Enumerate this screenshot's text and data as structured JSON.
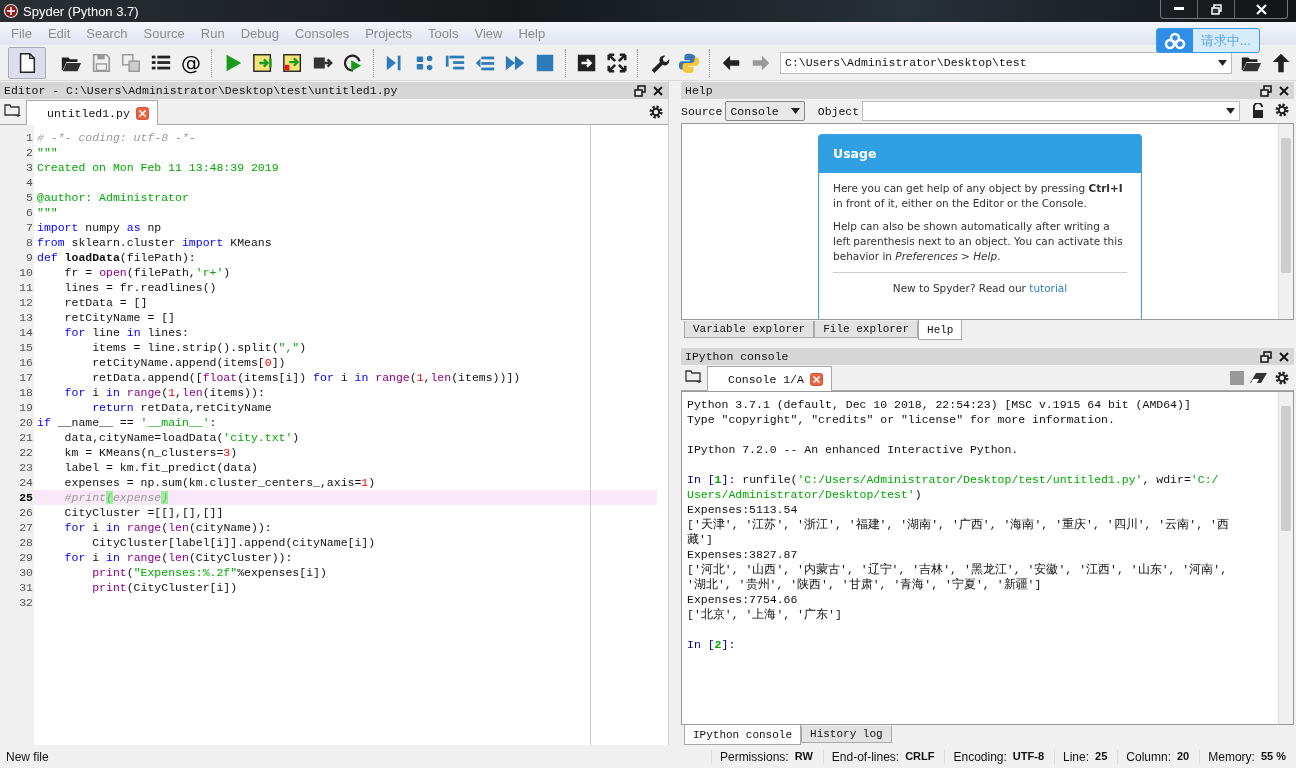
{
  "window": {
    "title": "Spyder (Python 3.7)"
  },
  "menu": [
    "File",
    "Edit",
    "Search",
    "Source",
    "Run",
    "Debug",
    "Consoles",
    "Projects",
    "Tools",
    "View",
    "Help"
  ],
  "toolbar": {
    "symbol_button": "@",
    "working_directory": "C:\\Users\\Administrator\\Desktop\\test"
  },
  "popup": {
    "text": "请求中..."
  },
  "editor": {
    "title": "Editor - C:\\Users\\Administrator\\Desktop\\test\\untitled1.py",
    "tabs": [
      {
        "label": "untitled1.py",
        "selected": true
      }
    ],
    "lines": [
      {
        "number": "1",
        "current": false,
        "tokens": [
          {
            "comment": "# -*- coding: utf-8 -*-"
          }
        ]
      },
      {
        "number": "2",
        "current": false,
        "tokens": [
          {
            "string": "\"\"\""
          }
        ]
      },
      {
        "number": "3",
        "current": false,
        "tokens": [
          {
            "string": "Created on Mon Feb 11 13:48:39 2019"
          }
        ]
      },
      {
        "number": "4",
        "current": false
      },
      {
        "number": "5",
        "current": false,
        "tokens": [
          {
            "string": "@author: Administrator"
          }
        ]
      },
      {
        "number": "6",
        "current": false,
        "tokens": [
          {
            "string": "\"\"\""
          }
        ]
      },
      {
        "number": "7",
        "current": false,
        "tokens": [
          {
            "keyword": "import"
          },
          {
            "plain": " numpy "
          },
          {
            "keyword": "as"
          },
          {
            "plain": " np"
          }
        ]
      },
      {
        "number": "8",
        "current": false,
        "tokens": [
          {
            "keyword": "from"
          },
          {
            "plain": " sklearn.cluster "
          },
          {
            "keyword": "import"
          },
          {
            "plain": " KMeans"
          }
        ]
      },
      {
        "number": "9",
        "current": false,
        "tokens": [
          {
            "keyword": "def "
          },
          {
            "name": "loadData"
          },
          {
            "plain": "(filePath):"
          }
        ]
      },
      {
        "number": "10",
        "current": false,
        "tokens": [
          {
            "plain": "    fr = "
          },
          {
            "builtin": "open"
          },
          {
            "plain": "(filePath,"
          },
          {
            "string": "'r+'"
          },
          {
            "plain": ")"
          }
        ]
      },
      {
        "number": "11",
        "current": false,
        "tokens": [
          {
            "plain": "    lines = fr.readlines()"
          }
        ]
      },
      {
        "number": "12",
        "current": false,
        "tokens": [
          {
            "plain": "    retData = []"
          }
        ]
      },
      {
        "number": "13",
        "current": false,
        "tokens": [
          {
            "plain": "    retCityName = []"
          }
        ]
      },
      {
        "number": "14",
        "current": false,
        "tokens": [
          {
            "keyword": "    for"
          },
          {
            "plain": " line "
          },
          {
            "keyword": "in"
          },
          {
            "plain": " lines:"
          }
        ]
      },
      {
        "number": "15",
        "current": false,
        "tokens": [
          {
            "plain": "        items = line.strip().split("
          },
          {
            "string": "\",\""
          },
          {
            "plain": ")"
          }
        ]
      },
      {
        "number": "16",
        "current": false,
        "tokens": [
          {
            "plain": "        retCityName.append(items["
          },
          {
            "number": "0"
          },
          {
            "plain": "])"
          }
        ]
      },
      {
        "number": "17",
        "current": false,
        "tokens": [
          {
            "plain": "        retData.append(["
          },
          {
            "builtin": "float"
          },
          {
            "plain": "(items[i]) "
          },
          {
            "keyword": "for"
          },
          {
            "plain": " i "
          },
          {
            "keyword": "in "
          },
          {
            "builtin": "range"
          },
          {
            "plain": "("
          },
          {
            "number": "1"
          },
          {
            "plain": ","
          },
          {
            "builtin": "len"
          },
          {
            "plain": "(items))])"
          }
        ]
      },
      {
        "number": "18",
        "current": false,
        "tokens": [
          {
            "keyword": "    for"
          },
          {
            "plain": " i "
          },
          {
            "keyword": "in "
          },
          {
            "builtin": "range"
          },
          {
            "plain": "("
          },
          {
            "number": "1"
          },
          {
            "plain": ","
          },
          {
            "builtin": "len"
          },
          {
            "plain": "(items)):"
          }
        ]
      },
      {
        "number": "19",
        "current": false,
        "tokens": [
          {
            "keyword": "        return"
          },
          {
            "plain": " retData,retCityName"
          }
        ]
      },
      {
        "number": "20",
        "current": false,
        "tokens": [
          {
            "keyword": "if"
          },
          {
            "plain": " __name__ == "
          },
          {
            "string": "'__main__'"
          },
          {
            "plain": ":"
          }
        ]
      },
      {
        "number": "21",
        "current": false,
        "tokens": [
          {
            "plain": "    data,cityName=loadData("
          },
          {
            "string": "'city.txt'"
          },
          {
            "plain": ")"
          }
        ]
      },
      {
        "number": "22",
        "current": false,
        "tokens": [
          {
            "plain": "    km = KMeans(n_clusters="
          },
          {
            "number": "3"
          },
          {
            "plain": ")"
          }
        ]
      },
      {
        "number": "23",
        "current": false,
        "tokens": [
          {
            "plain": "    label = km.fit_predict(data)"
          }
        ]
      },
      {
        "number": "24",
        "current": false,
        "tokens": [
          {
            "plain": "    expenses = np.sum(km.cluster_centers_,axis="
          },
          {
            "number": "1"
          },
          {
            "plain": ")"
          }
        ]
      },
      {
        "number": "25",
        "current": true,
        "tokens": [
          {
            "comment": "    #print"
          },
          {
            "match": "("
          },
          {
            "comment": "expense"
          },
          {
            "match": ")"
          }
        ]
      },
      {
        "number": "26",
        "current": false,
        "tokens": [
          {
            "plain": "    CityCluster =[[],[],[]]"
          }
        ]
      },
      {
        "number": "27",
        "current": false,
        "tokens": [
          {
            "keyword": "    for"
          },
          {
            "plain": " i "
          },
          {
            "keyword": "in "
          },
          {
            "builtin": "range"
          },
          {
            "plain": "("
          },
          {
            "builtin": "len"
          },
          {
            "plain": "(cityName)):"
          }
        ]
      },
      {
        "number": "28",
        "current": false,
        "tokens": [
          {
            "plain": "        CityCluster[label[i]].append(cityName[i])"
          }
        ]
      },
      {
        "number": "29",
        "current": false,
        "tokens": [
          {
            "keyword": "    for"
          },
          {
            "plain": " i "
          },
          {
            "keyword": "in "
          },
          {
            "builtin": "range"
          },
          {
            "plain": "("
          },
          {
            "builtin": "len"
          },
          {
            "plain": "(CityCluster)):"
          }
        ]
      },
      {
        "number": "30",
        "current": false,
        "tokens": [
          {
            "builtin": "        print"
          },
          {
            "plain": "("
          },
          {
            "string": "\"Expenses:%.2f\""
          },
          {
            "plain": "%expenses[i])"
          }
        ]
      },
      {
        "number": "31",
        "current": false,
        "tokens": [
          {
            "builtin": "        print"
          },
          {
            "plain": "(CityCluster[i])"
          }
        ]
      },
      {
        "number": "32",
        "current": false
      }
    ]
  },
  "help": {
    "title": "Help",
    "source": {
      "label": "Source",
      "value": "Console"
    },
    "object": {
      "label": "Object"
    },
    "card": {
      "heading": "Usage",
      "paragraphs": [
        "Here you can get help of any object by pressing **Ctrl+I** in front of it, either on the Editor or the Console.",
        "Help can also be shown automatically after writing a left parenthesis next to an object. You can activate this behavior in *Preferences > Help*."
      ],
      "footer": "New to Spyder? Read our",
      "link": "tutorial"
    },
    "tabs": [
      {
        "label": "Variable explorer",
        "selected": false
      },
      {
        "label": "File explorer",
        "selected": false
      },
      {
        "label": "Help",
        "selected": true
      }
    ]
  },
  "console": {
    "title": "IPython console",
    "tabs": [
      {
        "label": "Console 1/A",
        "selected": true
      }
    ],
    "blocks": [
      {
        "lines": [
          {
            "tokens": [
              {
                "plain": "Python 3.7.1 (default, Dec 10 2018, 22:54:23) [MSC v.1915 64 bit (AMD64)]"
              }
            ]
          },
          {
            "tokens": [
              {
                "plain": "Type \"copyright\", \"credits\" or \"license\" for more information."
              }
            ]
          }
        ]
      },
      {
        "lines": [
          {
            "tokens": [
              {
                "plain": "IPython 7.2.0 -- An enhanced Interactive Python."
              }
            ]
          }
        ]
      },
      {
        "lines": [
          {
            "tokens": [
              {
                "prompt": "In ["
              },
              {
                "prompt_number": "1"
              },
              {
                "prompt": "]: "
              },
              {
                "plain": "runfile("
              },
              {
                "string": "'C:/Users/Administrator/Desktop/test/untitled1.py'"
              },
              {
                "plain": ", wdir="
              },
              {
                "string": "'C:/"
              }
            ]
          },
          {
            "tokens": [
              {
                "string": "Users/Administrator/Desktop/test'"
              },
              {
                "plain": ")"
              }
            ]
          },
          {
            "tokens": [
              {
                "plain": "Expenses:5113.54"
              }
            ]
          },
          {
            "tokens": [
              {
                "plain": "['天津', '江苏', '浙江', '福建', '湖南', '广西', '海南', '重庆', '四川', '云南', '西"
              }
            ]
          },
          {
            "tokens": [
              {
                "plain": "藏']"
              }
            ]
          },
          {
            "tokens": [
              {
                "plain": "Expenses:3827.87"
              }
            ]
          },
          {
            "tokens": [
              {
                "plain": "['河北', '山西', '内蒙古', '辽宁', '吉林', '黑龙江', '安徽', '江西', '山东', '河南',"
              }
            ]
          },
          {
            "tokens": [
              {
                "plain": "'湖北', '贵州', '陕西', '甘肃', '青海', '宁夏', '新疆']"
              }
            ]
          },
          {
            "tokens": [
              {
                "plain": "Expenses:7754.66"
              }
            ]
          },
          {
            "tokens": [
              {
                "plain": "['北京', '上海', '广东']"
              }
            ]
          }
        ]
      },
      {
        "lines": [
          {
            "tokens": [
              {
                "prompt": "In ["
              },
              {
                "prompt_number": "2"
              },
              {
                "prompt": "]:"
              }
            ]
          }
        ]
      }
    ],
    "bottom_tabs": [
      {
        "label": "IPython console",
        "selected": true
      },
      {
        "label": "History log",
        "selected": false
      }
    ]
  },
  "status_bar": {
    "message": "New file",
    "fields": [
      {
        "label": "Permissions:",
        "value": "RW"
      },
      {
        "label": "End-of-lines:",
        "value": "CRLF"
      },
      {
        "label": "Encoding:",
        "value": "UTF-8"
      },
      {
        "label": "Line:",
        "value": "25"
      },
      {
        "label": "Column:",
        "value": "20"
      },
      {
        "label": "Memory:",
        "value": "55 %"
      }
    ]
  }
}
